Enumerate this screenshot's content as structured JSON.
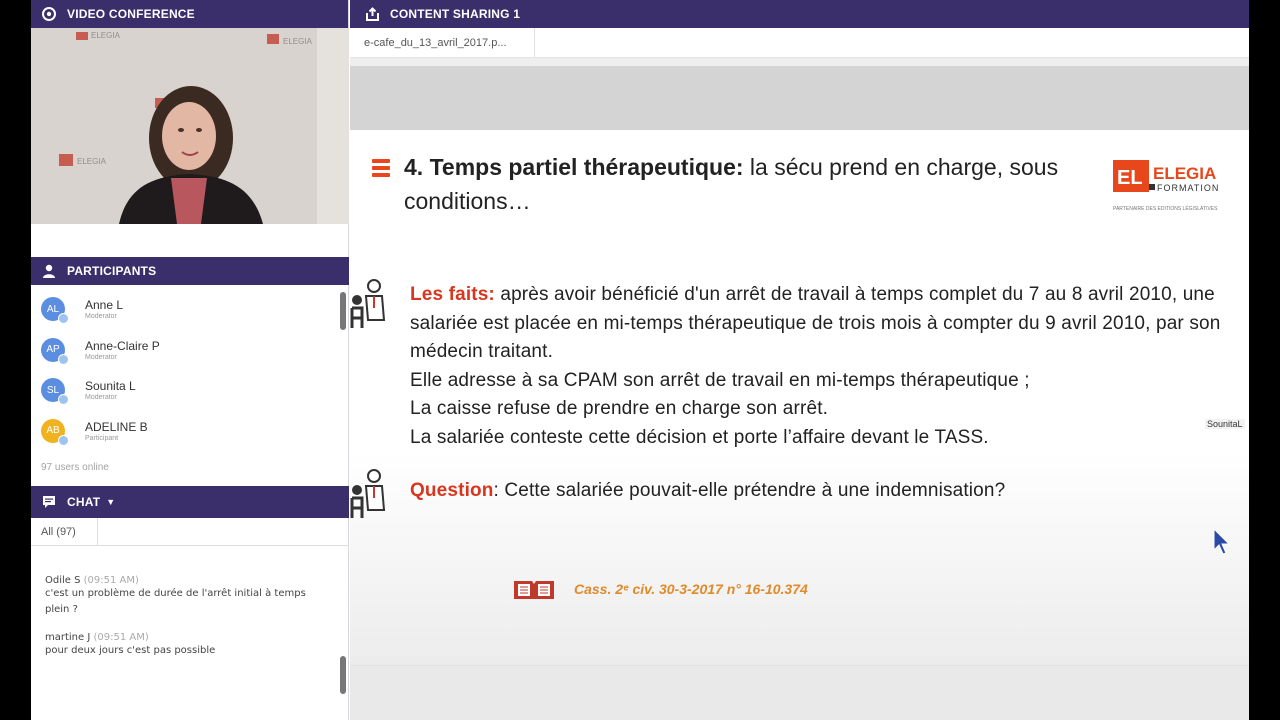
{
  "video_panel": {
    "title": "VIDEO CONFERENCE",
    "icon": "camera-icon"
  },
  "participants": {
    "title": "PARTICIPANTS",
    "icon": "user-icon",
    "items": [
      {
        "initials": "AL",
        "name": "Anne L",
        "role": "Moderator",
        "color": "#5b8ee0"
      },
      {
        "initials": "AP",
        "name": "Anne-Claire P",
        "role": "Moderator",
        "color": "#5b8ee0"
      },
      {
        "initials": "SL",
        "name": "Sounita L",
        "role": "Moderator",
        "color": "#5b8ee0"
      },
      {
        "initials": "AB",
        "name": "ADELINE B",
        "role": "Participant",
        "color": "#f0b21d"
      }
    ],
    "online": "97 users online"
  },
  "chat": {
    "title": "CHAT",
    "icon": "chat-icon",
    "tab": "All (97)",
    "messages": [
      {
        "author": "Odile S",
        "time": "(09:51 AM)",
        "text": "c'est un problème de durée de l'arrêt initial à temps plein ?"
      },
      {
        "author": "martine J",
        "time": "(09:51 AM)",
        "text": "pour deux jours c'est pas possible"
      }
    ]
  },
  "content": {
    "title": "CONTENT SHARING 1",
    "icon": "share-icon",
    "file_tab": "e-cafe_du_13_avril_2017.p..."
  },
  "slide": {
    "title_bold": "4. Temps partiel thérapeutique:",
    "title_rest": " la sécu prend en charge, sous conditions…",
    "logo": {
      "letters": "EL",
      "brand": "ELEGIA",
      "sub": "FORMATION",
      "tagline": "PARTENAIRE DES EDITIONS LÉGISLATIVES"
    },
    "faits_label": "Les faits:",
    "faits_text": " après avoir bénéficié d'un arrêt de travail à temps complet du 7 au 8 avril 2010, une salariée est placée en mi-temps thérapeutique de trois mois à compter du 9 avril 2010, par son médecin traitant.",
    "line2": "Elle adresse à sa CPAM son arrêt de travail en mi-temps thérapeutique ;",
    "line3": "La caisse refuse de prendre en charge son arrêt.",
    "line4": "La salariée conteste cette décision et porte l’affaire devant le TASS.",
    "question_label": "Question",
    "question_text": ": Cette salariée pouvait-elle prétendre à une indemnisation?",
    "reference": "Cass. 2ᵉ civ. 30-3-2017 n° 16-10.374"
  },
  "cursor_label": "SounitaL"
}
